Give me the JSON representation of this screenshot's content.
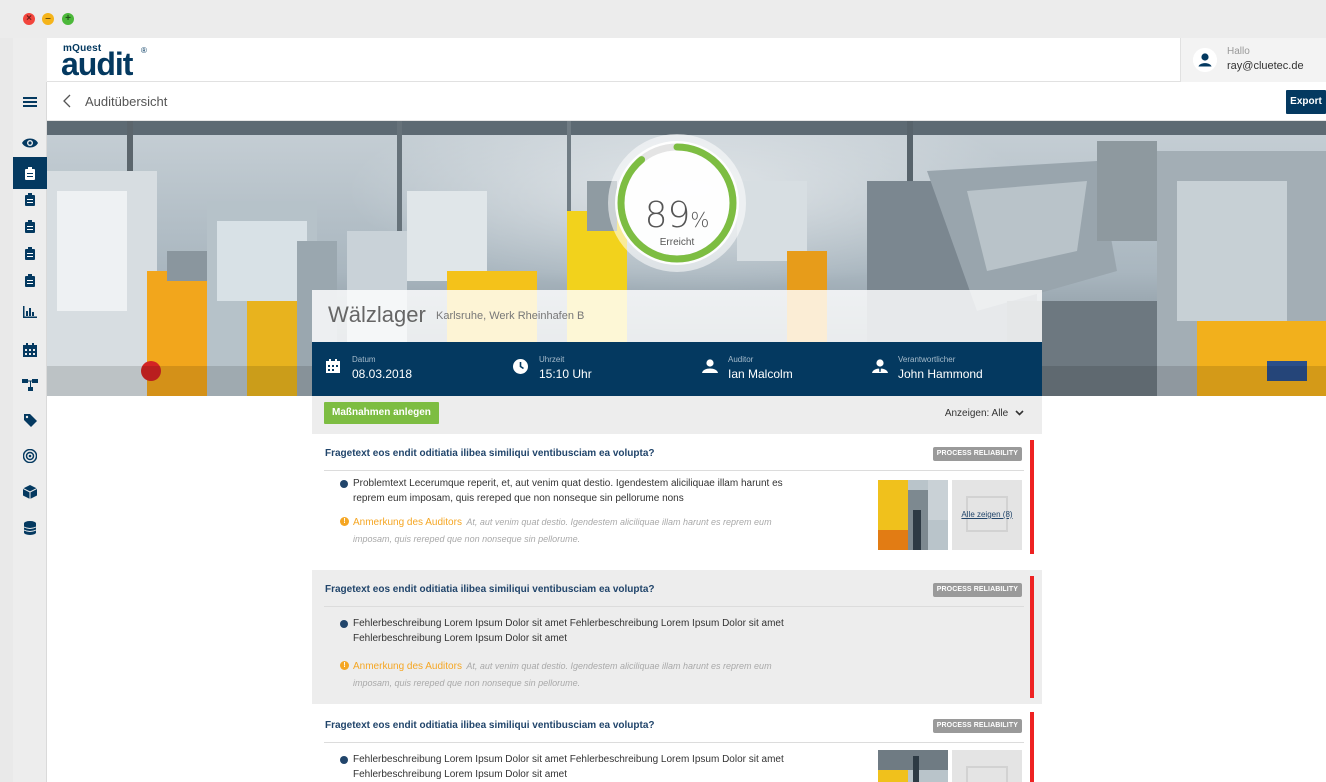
{
  "window": {
    "close_glyph": "×",
    "minimize_glyph": "–",
    "zoom_glyph": "+"
  },
  "header": {
    "logo_small": "mQuest",
    "logo_big": "audit",
    "logo_reg": "®",
    "greeting": "Hallo",
    "user_email": "ray@cluetec.de"
  },
  "subbar": {
    "breadcrumb": "Auditübersicht",
    "export_label": "Export"
  },
  "nav": {
    "items": [
      {
        "icon": "menu-icon"
      },
      {
        "icon": "eye-icon"
      },
      {
        "icon": "clipboard-icon",
        "active": true
      },
      {
        "icon": "clipboard-icon"
      },
      {
        "icon": "clipboard-icon"
      },
      {
        "icon": "clipboard-icon"
      },
      {
        "icon": "clipboard-icon"
      },
      {
        "icon": "chart-icon"
      },
      {
        "icon": "calendar-icon"
      },
      {
        "icon": "hierarchy-icon"
      },
      {
        "icon": "tag-icon"
      },
      {
        "icon": "target-icon"
      },
      {
        "icon": "cube-icon"
      },
      {
        "icon": "database-icon"
      }
    ]
  },
  "gauge": {
    "value": 89,
    "value_text": "89",
    "unit": "%",
    "label": "Erreicht",
    "accent": "#7dbd42"
  },
  "audit": {
    "title": "Wälzlager",
    "location": "Karlsruhe, Werk Rheinhafen B",
    "meta": {
      "date_label": "Datum",
      "date_value": "08.03.2018",
      "time_label": "Uhrzeit",
      "time_value": "15:10 Uhr",
      "auditor_label": "Auditor",
      "auditor_value": "Ian Malcolm",
      "responsible_label": "Verantwortlicher",
      "responsible_value": "John Hammond"
    }
  },
  "toolbar": {
    "create_measures_label": "Maßnahmen anlegen",
    "filter_label": "Anzeigen: Alle"
  },
  "questions": [
    {
      "title": "Fragetext eos endit oditiatia ilibea similiqui ventibusciam ea volupta?",
      "tag": "PROCESS RELIABILITY",
      "problem": "Problemtext Lecerumque reperit, et, aut venim quat destio. Igendestem aliciliquae illam harunt es reprem eum imposam, quis rereped que non nonseque sin pellorume nons",
      "note_label": "Anmerkung des Auditors",
      "note_text": "At, aut venim quat destio. Igendestem aliciliquae illam harunt es reprem eum imposam, quis rereped que non nonseque sin pellorume.",
      "show_all_label": "Alle zeigen (8)"
    },
    {
      "title": "Fragetext eos endit oditiatia ilibea similiqui ventibusciam ea volupta?",
      "tag": "PROCESS RELIABILITY",
      "problem": "Fehlerbeschreibung Lorem Ipsum Dolor sit amet Fehlerbeschreibung Lorem Ipsum Dolor sit amet Fehlerbeschreibung Lorem Ipsum Dolor sit amet",
      "note_label": "Anmerkung des Auditors",
      "note_text": "At, aut venim quat destio. Igendestem aliciliquae illam harunt es reprem eum imposam, quis rereped que non nonseque sin pellorume."
    },
    {
      "title": "Fragetext eos endit oditiatia ilibea similiqui ventibusciam ea volupta?",
      "tag": "PROCESS RELIABILITY",
      "problem": "Fehlerbeschreibung Lorem Ipsum Dolor sit amet Fehlerbeschreibung Lorem Ipsum Dolor sit amet Fehlerbeschreibung Lorem Ipsum Dolor sit amet"
    }
  ],
  "colors": {
    "primary": "#043960",
    "green": "#7dbd42",
    "warning": "#f5a623",
    "alert": "#ee2222"
  }
}
